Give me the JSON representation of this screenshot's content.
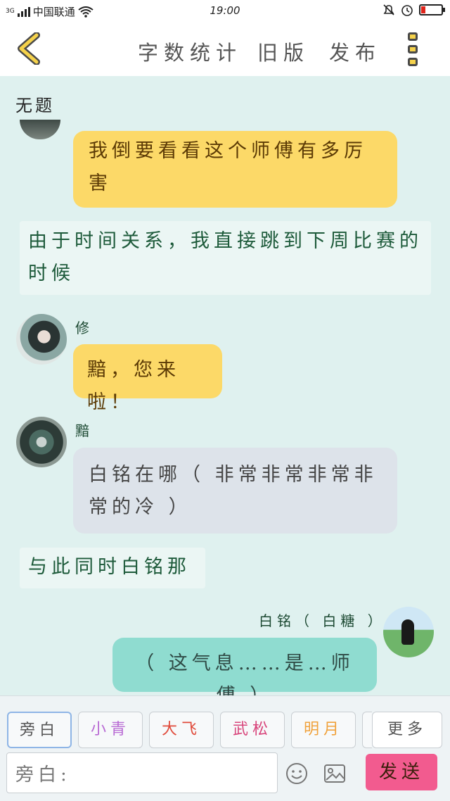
{
  "status_bar": {
    "network": "3G",
    "carrier": "中国联通",
    "time": "19:00"
  },
  "header": {
    "nav": {
      "word_count": "字数统计",
      "old_version": "旧版",
      "publish": "发布"
    }
  },
  "chat": {
    "title": "无题",
    "messages": [
      {
        "type": "bubble",
        "style": "yellow",
        "text": "我倒要看看这个师傅有多厉害"
      },
      {
        "type": "narration",
        "text": "由于时间关系，我直接跳到下周比赛的时候"
      },
      {
        "type": "bubble",
        "style": "yellow",
        "sender": "修",
        "text": "黯，您来啦！"
      },
      {
        "type": "bubble",
        "style": "gray",
        "sender": "黯",
        "text": "白铭在哪（ 非常非常非常非常的冷 ）"
      },
      {
        "type": "narration",
        "text": "与此同时白铭那"
      },
      {
        "type": "bubble",
        "style": "teal",
        "sender": "白铭（ 白糖 ）",
        "text": "（ 这气息……是…师傅 ）"
      }
    ]
  },
  "roles": [
    "旁白",
    "小青",
    "大飞",
    "武松",
    "明月"
  ],
  "more_roles": "更多",
  "composer": {
    "input_value": "旁白:",
    "send": "发送"
  },
  "colors": {
    "accent_yellow": "#fcd968",
    "send_pink": "#f25b8f",
    "chat_bg": "#dff1ef"
  },
  "icons": [
    "back-arrow-icon",
    "more-icon",
    "emoji-icon",
    "image-icon",
    "alarm-icon",
    "clock-icon",
    "battery-icon",
    "wifi-icon"
  ]
}
